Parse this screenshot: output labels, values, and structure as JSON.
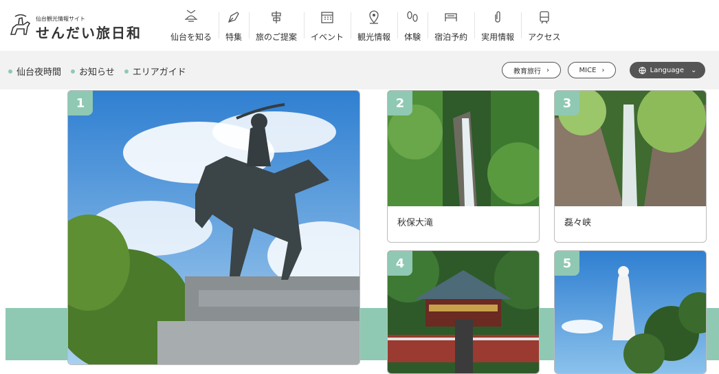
{
  "logo": {
    "sub": "仙台観光情報サイト",
    "main": "せんだい旅日和"
  },
  "gnav": [
    {
      "label": "仙台を知る",
      "icon": "helmet-icon"
    },
    {
      "label": "特集",
      "icon": "pen-icon"
    },
    {
      "label": "旅のご提案",
      "icon": "signpost-icon"
    },
    {
      "label": "イベント",
      "icon": "calendar-icon"
    },
    {
      "label": "観光情報",
      "icon": "location-pin-icon"
    },
    {
      "label": "体験",
      "icon": "footprints-icon"
    },
    {
      "label": "宿泊予約",
      "icon": "bed-icon"
    },
    {
      "label": "実用情報",
      "icon": "paperclip-icon"
    },
    {
      "label": "アクセス",
      "icon": "train-icon"
    }
  ],
  "subnav": [
    {
      "label": "仙台夜時間"
    },
    {
      "label": "お知らせ"
    },
    {
      "label": "エリアガイド"
    }
  ],
  "buttons": {
    "education": "教育旅行",
    "mice": "MICE",
    "language": "Language"
  },
  "cards": [
    {
      "number": "1",
      "title": ""
    },
    {
      "number": "2",
      "title": "秋保大滝"
    },
    {
      "number": "3",
      "title": "磊々峡"
    },
    {
      "number": "4",
      "title": ""
    },
    {
      "number": "5",
      "title": ""
    }
  ],
  "colors": {
    "accent": "#8fc9b3",
    "dark": "#555555"
  }
}
